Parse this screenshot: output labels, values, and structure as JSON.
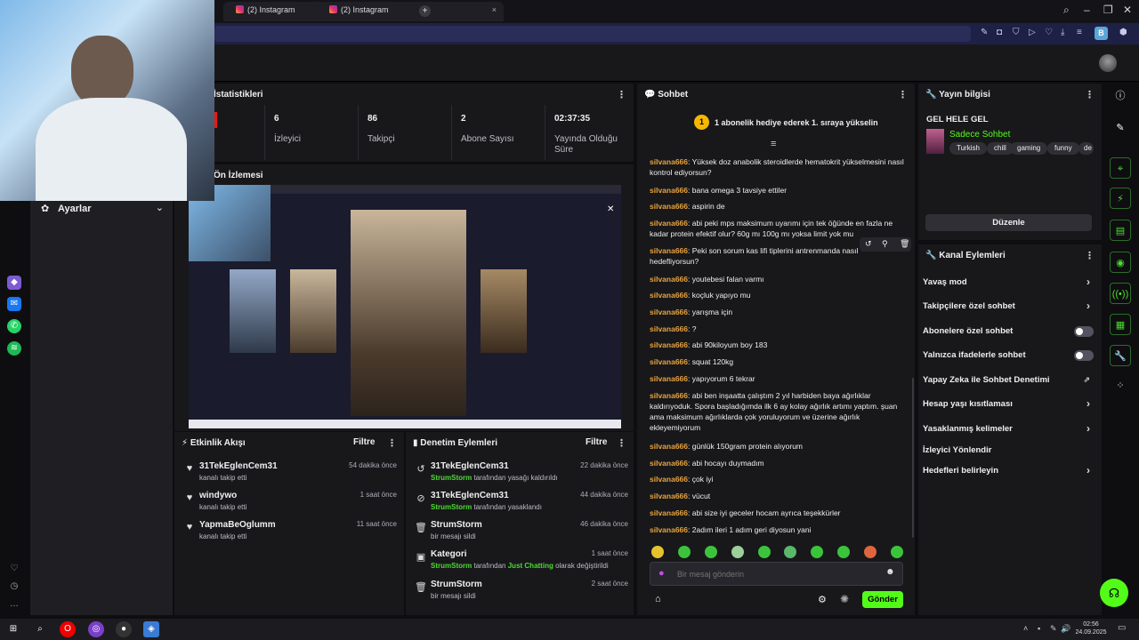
{
  "browser": {
    "tabs": [
      {
        "label": "(2) Instagram"
      },
      {
        "label": "(2) Instagram"
      }
    ],
    "profile_initial": "B"
  },
  "sidebar": {
    "settings_label": "Ayarlar"
  },
  "stats_panel": {
    "title": "İstatistikleri",
    "items": [
      {
        "value": "6",
        "label": "İzleyici"
      },
      {
        "value": "86",
        "label": "Takipçi"
      },
      {
        "value": "2",
        "label": "Abone Sayısı"
      },
      {
        "value": "02:37:35",
        "label": "Yayında Olduğu Süre"
      }
    ]
  },
  "preview_panel": {
    "title": "Ön İzlemesi"
  },
  "activity_feed": {
    "title": "Etkinlik Akışı",
    "filter": "Filtre",
    "items": [
      {
        "name": "31TekEglenCem31",
        "sub": "kanalı takip etti",
        "time": "54 dakika önce"
      },
      {
        "name": "windywo",
        "sub": "kanalı takip etti",
        "time": "1 saat önce"
      },
      {
        "name": "YapmaBeOglumm",
        "sub": "kanalı takip etti",
        "time": "11 saat önce"
      }
    ]
  },
  "mod_actions": {
    "title": "Denetim Eylemleri",
    "filter": "Filtre",
    "items": [
      {
        "name": "31TekEglenCem31",
        "actor": "StrumStorm",
        "sub": "tarafından yasağı kaldırıldı",
        "time": "22 dakika önce"
      },
      {
        "name": "31TekEglenCem31",
        "actor": "StrumStorm",
        "sub": "tarafından yasaklandı",
        "time": "44 dakika önce"
      },
      {
        "name": "StrumStorm",
        "actor": "",
        "sub": "bir mesajı sildi",
        "time": "46 dakika önce"
      },
      {
        "name": "Kategori",
        "actor": "StrumStorm",
        "sub": "tarafından",
        "sub_hl": "Just Chatting",
        "sub_tail": "olarak değiştirildi",
        "time": "1 saat önce"
      },
      {
        "name": "StrumStorm",
        "actor": "",
        "sub": "bir mesajı sildi",
        "time": "2 saat önce"
      }
    ]
  },
  "chat": {
    "title": "Sohbet",
    "gift_banner": "1 abonelik hediye ederek 1. sıraya yükselin",
    "gift_rank": "1",
    "messages": [
      {
        "user": "silvana666",
        "text": "Yüksek doz anabolik steroidlerde hematokrit yükselmesini nasıl kontrol ediyorsun?"
      },
      {
        "user": "silvana666",
        "text": "bana omega 3 tavsiye ettiler"
      },
      {
        "user": "silvana666",
        "text": "aspirin de"
      },
      {
        "user": "silvana666",
        "text": "abi peki mps maksimum uyarımı için tek öğünde en fazla ne kadar protein efektif olur? 60g mı 100g mı yoksa limit yok mu"
      },
      {
        "user": "silvana666",
        "text": "Peki son sorum kas lifi tiplerini antrenmanda nasıl hedefliyorsun?"
      },
      {
        "user": "silvana666",
        "text": "youtebesi falan varmı"
      },
      {
        "user": "silvana666",
        "text": "koçluk yapıyo mu"
      },
      {
        "user": "silvana666",
        "text": "yarışma için"
      },
      {
        "user": "silvana666",
        "text": "?"
      },
      {
        "user": "silvana666",
        "text": "abi 90kiloyum boy 183"
      },
      {
        "user": "silvana666",
        "text": "squat 120kg"
      },
      {
        "user": "silvana666",
        "text": "yapıyorum 6 tekrar"
      },
      {
        "user": "silvana666",
        "text": "abi ben inşaatta çalıştım 2 yıl harbiden baya ağırlıklar kaldırıyoduk. Spora başladığımda ilk 6 ay kolay ağırlık artımı yaptım. şuan ama maksimum ağırlıklarda çok yoruluyorum ve üzerine ağırlık ekleyemiyorum"
      },
      {
        "user": "silvana666",
        "text": "günlük 150gram protein alıyorum"
      },
      {
        "user": "silvana666",
        "text": "abi hocayı duymadım"
      },
      {
        "user": "silvana666",
        "text": "çok iyi"
      },
      {
        "user": "silvana666",
        "text": "vücut"
      },
      {
        "user": "silvana666",
        "text": "abi size iyi geceler hocam ayrıca teşekkürler"
      },
      {
        "user": "silvana666",
        "text": "2adım ileri 1 adım geri diyosun yani"
      }
    ],
    "input_placeholder": "Bir mesaj gönderin",
    "send_label": "Gönder"
  },
  "stream_info": {
    "title": "Yayın bilgisi",
    "stream_title": "GEL HELE GEL",
    "category": "Sadece Sohbet",
    "tags": [
      "Turkish",
      "chill",
      "gaming",
      "funny",
      "de"
    ],
    "edit_label": "Düzenle"
  },
  "channel_actions": {
    "title": "Kanal Eylemleri",
    "items": [
      {
        "label": "Yavaş mod",
        "kind": "chevron"
      },
      {
        "label": "Takipçilere özel sohbet",
        "kind": "chevron"
      },
      {
        "label": "Abonelere özel sohbet",
        "kind": "toggle"
      },
      {
        "label": "Yalnızca ifadelerle sohbet",
        "kind": "toggle"
      },
      {
        "label": "Yapay Zeka ile Sohbet Denetimi",
        "kind": "external"
      },
      {
        "label": "Hesap yaşı kısıtlaması",
        "kind": "chevron"
      },
      {
        "label": "Yasaklanmış kelimeler",
        "kind": "chevron"
      },
      {
        "label": "İzleyici Yönlendir",
        "kind": "none"
      },
      {
        "label": "Hedefleri belirleyin",
        "kind": "chevron"
      }
    ]
  },
  "taskbar": {
    "time": "02:56",
    "date": "24.09.2025"
  },
  "colors": {
    "accent_green": "#4cdc31",
    "chat_user": "#e8a33d"
  }
}
